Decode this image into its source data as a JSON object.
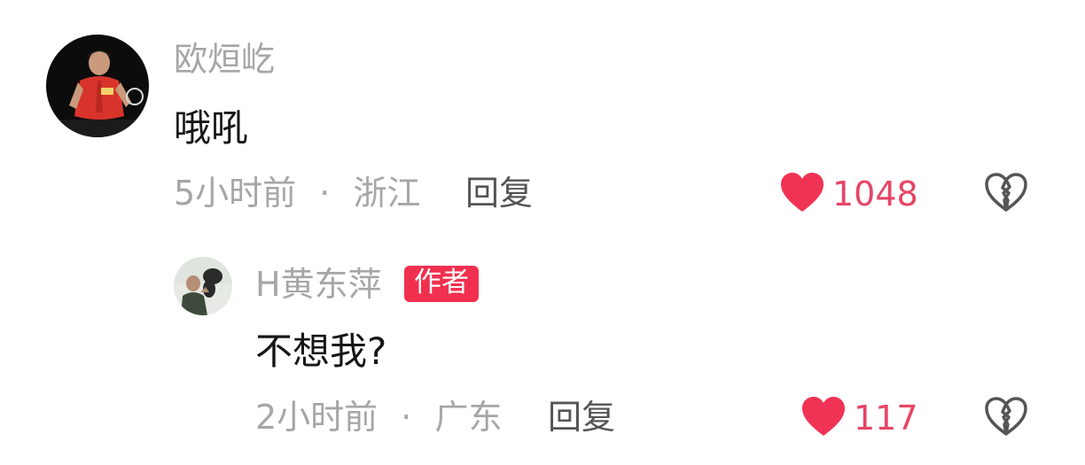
{
  "comments": [
    {
      "username": "欧烜屹",
      "text": "哦吼",
      "time": "5小时前",
      "separator": "·",
      "location": "浙江",
      "reply_label": "回复",
      "likes": "1048"
    }
  ],
  "reply": {
    "username": "H黄东萍",
    "badge": "作者",
    "text": "不想我?",
    "time": "2小时前",
    "separator": "·",
    "location": "广东",
    "reply_label": "回复",
    "likes": "117"
  },
  "colors": {
    "like_red": "#f03355",
    "badge_red": "#f1304f",
    "muted_text": "#a6a6a6"
  },
  "icons": [
    "avatar",
    "heart-icon",
    "broken-heart-icon"
  ]
}
